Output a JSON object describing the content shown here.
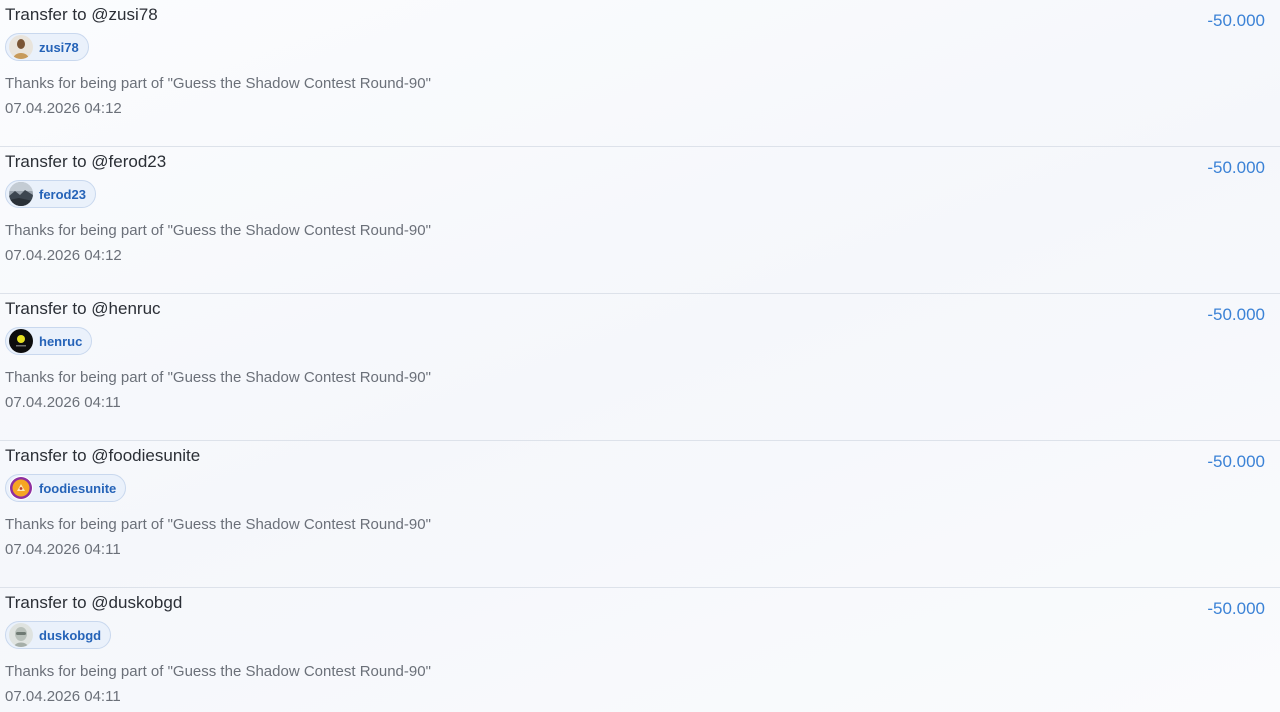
{
  "transactions": [
    {
      "title": "Transfer to @zusi78",
      "user": "zusi78",
      "avatar_icon": "person-photo-icon",
      "memo": "Thanks for being part of \"Guess the Shadow Contest Round-90\"",
      "date": "07.04.2026 04:12",
      "amount": "-50.000"
    },
    {
      "title": "Transfer to @ferod23",
      "user": "ferod23",
      "avatar_icon": "landscape-photo-icon",
      "memo": "Thanks for being part of \"Guess the Shadow Contest Round-90\"",
      "date": "07.04.2026 04:12",
      "amount": "-50.000"
    },
    {
      "title": "Transfer to @henruc",
      "user": "henruc",
      "avatar_icon": "dark-logo-icon",
      "memo": "Thanks for being part of \"Guess the Shadow Contest Round-90\"",
      "date": "07.04.2026 04:11",
      "amount": "-50.000"
    },
    {
      "title": "Transfer to @foodiesunite",
      "user": "foodiesunite",
      "avatar_icon": "orange-logo-icon",
      "memo": "Thanks for being part of \"Guess the Shadow Contest Round-90\"",
      "date": "07.04.2026 04:11",
      "amount": "-50.000"
    },
    {
      "title": "Transfer to @duskobgd",
      "user": "duskobgd",
      "avatar_icon": "statue-photo-icon",
      "memo": "Thanks for being part of \"Guess the Shadow Contest Round-90\"",
      "date": "07.04.2026 04:11",
      "amount": "-50.000"
    }
  ],
  "colors": {
    "amount": "#3b82d6",
    "chip_bg": "#eaf1fb",
    "chip_text": "#2563b8",
    "title": "#2b2f36",
    "muted": "#6b7079"
  }
}
